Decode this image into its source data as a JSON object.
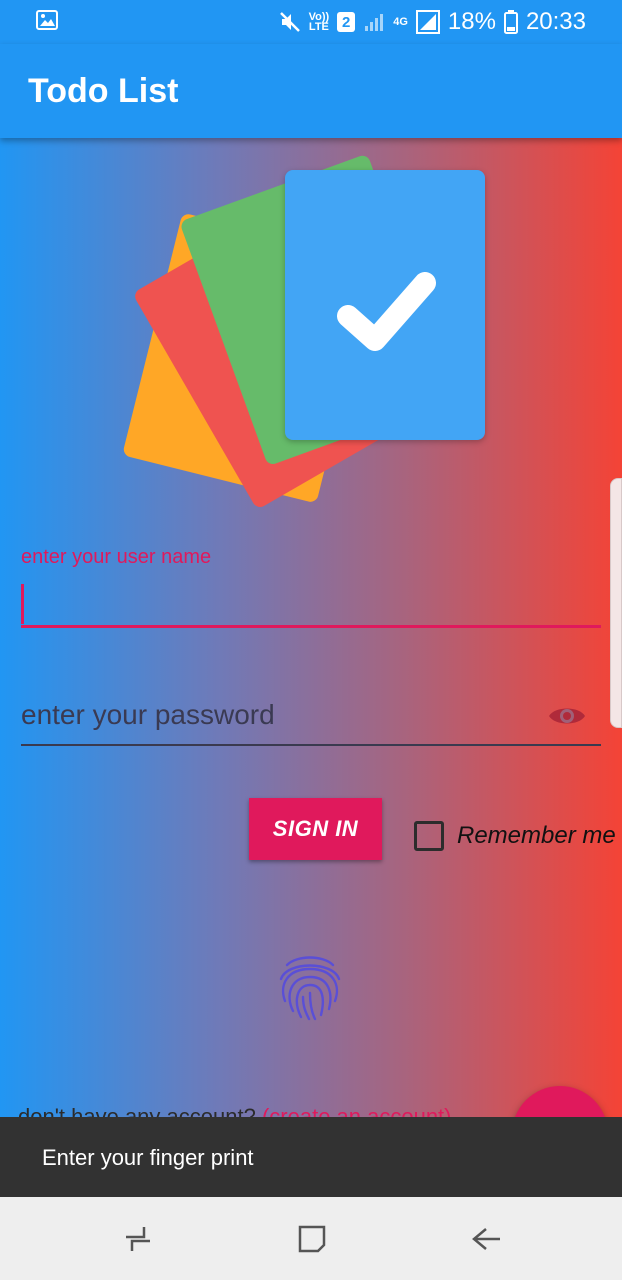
{
  "status_bar": {
    "battery_percent": "18%",
    "time": "20:33",
    "sim_slot": "2",
    "network_type": "4G",
    "volte_label": "Vo)) LTE",
    "icons": [
      "gallery-icon",
      "mute-icon",
      "volte-icon",
      "sim-2-icon",
      "signal-icon",
      "signal-4g-icon",
      "battery-icon"
    ]
  },
  "app_bar": {
    "title": "Todo List"
  },
  "login": {
    "username_label": "enter your user name",
    "username_value": "",
    "password_placeholder": "enter your password",
    "sign_in_label": "SIGN IN",
    "remember_label": "Remember me",
    "remember_checked": false
  },
  "signup": {
    "prompt": "don't have any account?",
    "link": "(create an account)"
  },
  "snackbar": {
    "message": "Enter your finger print"
  },
  "colors": {
    "primary": "#2196F3",
    "accent": "#e0195c",
    "gradient_end": "#f44336",
    "card_orange": "#FFA726",
    "card_red": "#EF5350",
    "card_green": "#66BB6A",
    "card_blue": "#42A5F5",
    "fingerprint": "#5a4fd6"
  },
  "nav_bar": {
    "icons": [
      "recent-apps-icon",
      "home-icon",
      "back-icon"
    ]
  }
}
